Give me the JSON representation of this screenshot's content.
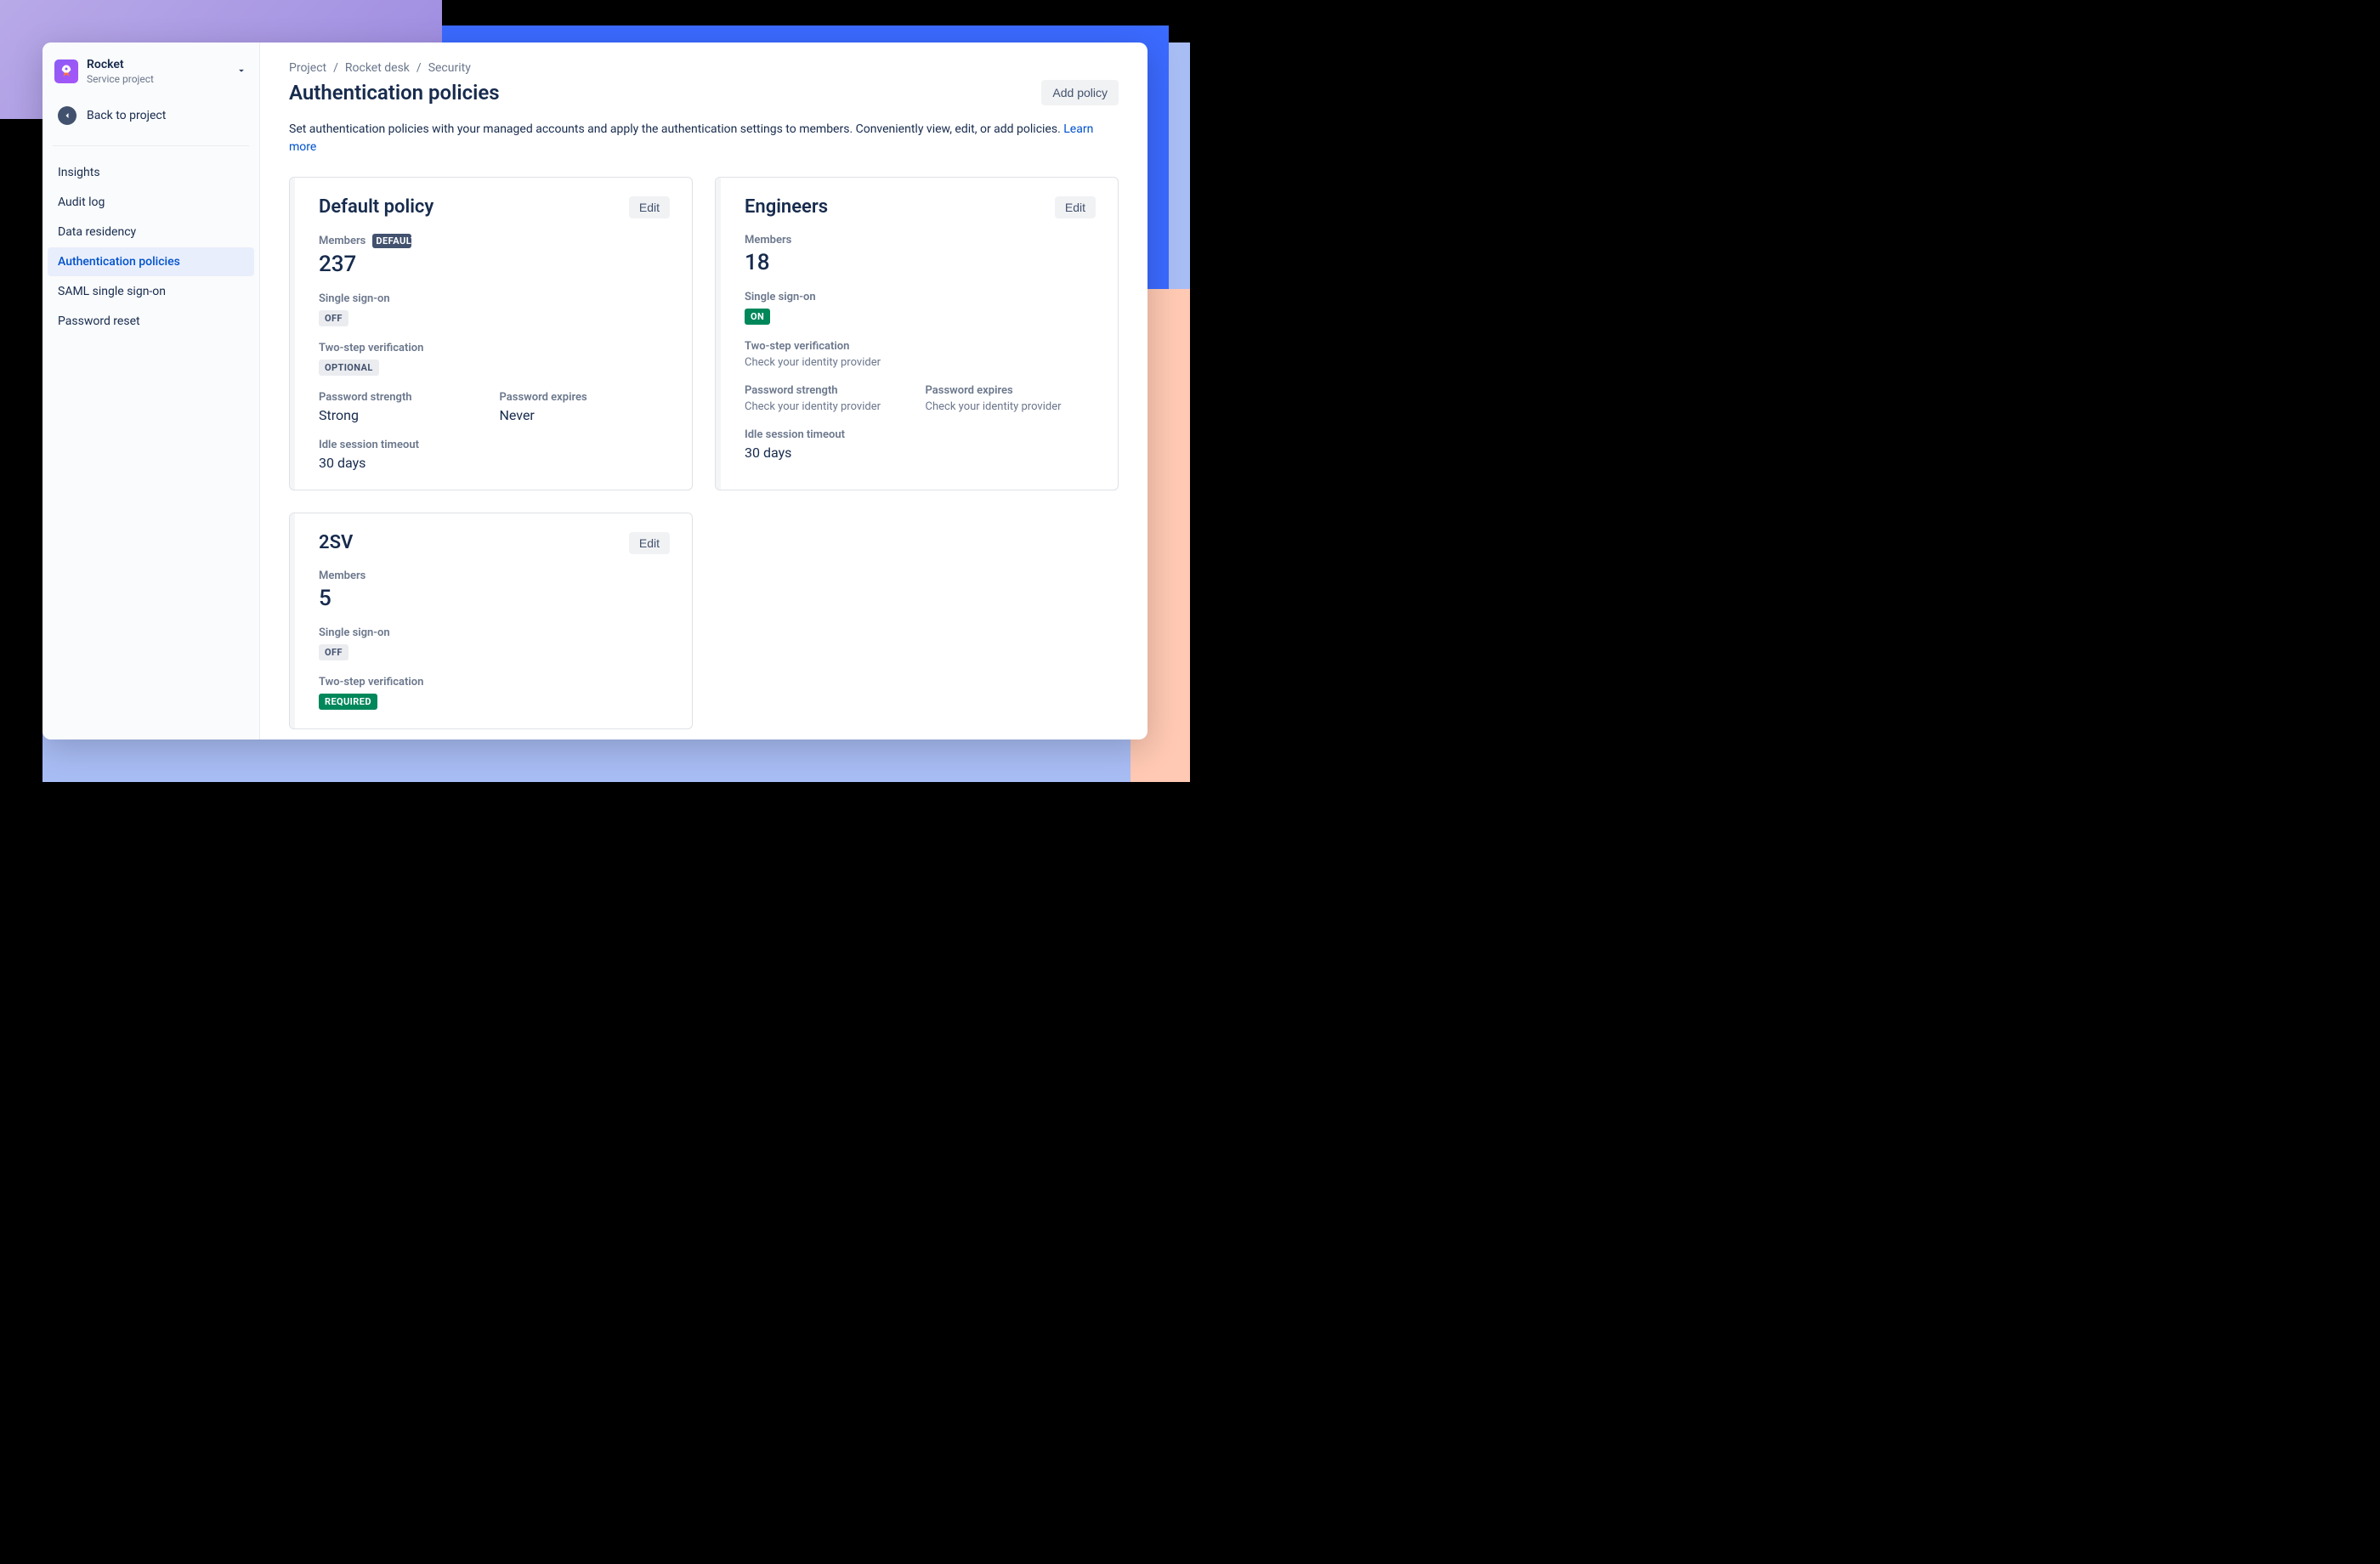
{
  "project": {
    "name": "Rocket",
    "subtitle": "Service project",
    "back_label": "Back to project"
  },
  "sidebar": {
    "items": [
      {
        "label": "Insights",
        "active": false
      },
      {
        "label": "Audit log",
        "active": false
      },
      {
        "label": "Data residency",
        "active": false
      },
      {
        "label": "Authentication policies",
        "active": true
      },
      {
        "label": "SAML single sign-on",
        "active": false
      },
      {
        "label": "Password reset",
        "active": false
      }
    ]
  },
  "breadcrumb": [
    "Project",
    "Rocket desk",
    "Security"
  ],
  "page": {
    "title": "Authentication policies",
    "add_button": "Add policy",
    "intro": "Set authentication policies with your managed accounts and apply the authentication settings to members. Conveniently view, edit, or add policies.",
    "learn_more": "Learn more"
  },
  "labels": {
    "members": "Members",
    "default_badge": "DEFAULT",
    "sso": "Single sign-on",
    "twostep": "Two-step verification",
    "pw_strength": "Password strength",
    "pw_expires": "Password expires",
    "idle": "Idle session timeout",
    "edit": "Edit",
    "check_idp": "Check your identity provider"
  },
  "policies": [
    {
      "title": "Default policy",
      "is_default": true,
      "members": "237",
      "sso": {
        "pill": "OFF",
        "pill_class": "pill-gray"
      },
      "twostep": {
        "pill": "OPTIONAL",
        "pill_class": "pill-gray"
      },
      "pw_strength": "Strong",
      "pw_expires": "Never",
      "idle": "30 days"
    },
    {
      "title": "Engineers",
      "is_default": false,
      "members": "18",
      "sso": {
        "pill": "ON",
        "pill_class": "pill-green"
      },
      "twostep": {
        "text": "Check your identity provider"
      },
      "pw_strength_text": "Check your identity provider",
      "pw_expires_text": "Check your identity provider",
      "idle": "30 days"
    },
    {
      "title": "2SV",
      "is_default": false,
      "members": "5",
      "sso": {
        "pill": "OFF",
        "pill_class": "pill-gray"
      },
      "twostep": {
        "pill": "REQUIRED",
        "pill_class": "pill-green"
      }
    }
  ]
}
